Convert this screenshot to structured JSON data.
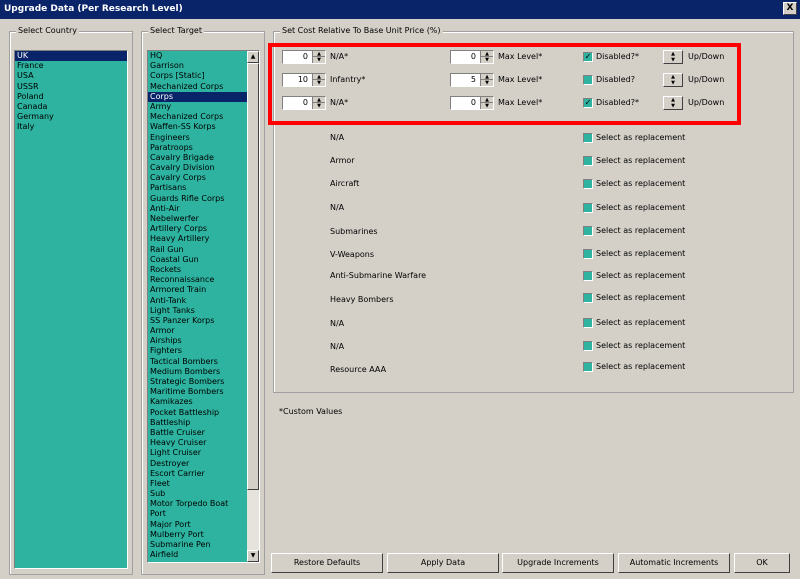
{
  "window": {
    "title": "Upgrade Data (Per Research Level)",
    "close_glyph": "X"
  },
  "country_panel": {
    "label": "Select Country",
    "items": [
      "UK",
      "France",
      "USA",
      "USSR",
      "Poland",
      "Canada",
      "Germany",
      "Italy"
    ],
    "selected": "UK"
  },
  "target_panel": {
    "label": "Select Target",
    "items": [
      "HQ",
      "Garrison",
      "Corps [Static]",
      "Mechanized Corps",
      "Corps",
      "Army",
      "Mechanized Corps",
      "Waffen-SS Korps",
      "Engineers",
      "Paratroops",
      "Cavalry Brigade",
      "Cavalry Division",
      "Cavalry Corps",
      "Partisans",
      "Guards Rifle Corps",
      "Anti-Air",
      "Nebelwerfer",
      "Artillery Corps",
      "Heavy Artillery",
      "Rail Gun",
      "Coastal Gun",
      "Rockets",
      "Reconnaissance",
      "Armored Train",
      "Anti-Tank",
      "Light Tanks",
      "SS Panzer Korps",
      "Armor",
      "Airships",
      "Fighters",
      "Tactical Bombers",
      "Medium Bombers",
      "Strategic Bombers",
      "Maritime Bombers",
      "Kamikazes",
      "Pocket Battleship",
      "Battleship",
      "Battle Cruiser",
      "Heavy Cruiser",
      "Light Cruiser",
      "Destroyer",
      "Escort Carrier",
      "Fleet",
      "Sub",
      "Motor Torpedo Boat",
      "Port",
      "Major Port",
      "Mulberry Port",
      "Submarine Pen",
      "Airfield"
    ],
    "selected": "Corps"
  },
  "cost_panel": {
    "label": "Set Cost Relative To Base Unit Price (%)",
    "custom_rows": [
      {
        "cost": "0",
        "name": "N/A*",
        "max_level": "0",
        "max_level_label": "Max Level*",
        "disabled_label": "Disabled?*",
        "disabled": true,
        "updown_label": "Up/Down"
      },
      {
        "cost": "10",
        "name": "Infantry*",
        "max_level": "5",
        "max_level_label": "Max Level*",
        "disabled_label": "Disabled?",
        "disabled": false,
        "updown_label": "Up/Down"
      },
      {
        "cost": "0",
        "name": "N/A*",
        "max_level": "0",
        "max_level_label": "Max Level*",
        "disabled_label": "Disabled?*",
        "disabled": true,
        "updown_label": "Up/Down"
      }
    ],
    "replacement_rows": [
      {
        "name": "N/A",
        "label": "Select as replacement"
      },
      {
        "name": "Armor",
        "label": "Select as replacement"
      },
      {
        "name": "Aircraft",
        "label": "Select as replacement"
      },
      {
        "name": "N/A",
        "label": "Select as replacement"
      },
      {
        "name": "Submarines",
        "label": "Select as replacement"
      },
      {
        "name": "V-Weapons",
        "label": "Select as replacement"
      },
      {
        "name": "Anti-Submarine Warfare",
        "label": "Select as replacement"
      },
      {
        "name": "Heavy Bombers",
        "label": "Select as replacement"
      },
      {
        "name": "N/A",
        "label": "Select as replacement"
      },
      {
        "name": "N/A",
        "label": "Select as replacement"
      },
      {
        "name": "Resource AAA",
        "label": "Select as replacement"
      }
    ],
    "note": "*Custom Values"
  },
  "buttons": {
    "restore": "Restore Defaults",
    "apply": "Apply Data",
    "upgrade_increments": "Upgrade Increments",
    "automatic_increments": "Automatic Increments",
    "ok": "OK"
  },
  "colors": {
    "list_bg": "#2db3a0",
    "selection": "#0a246a",
    "highlight": "#ff0000"
  }
}
